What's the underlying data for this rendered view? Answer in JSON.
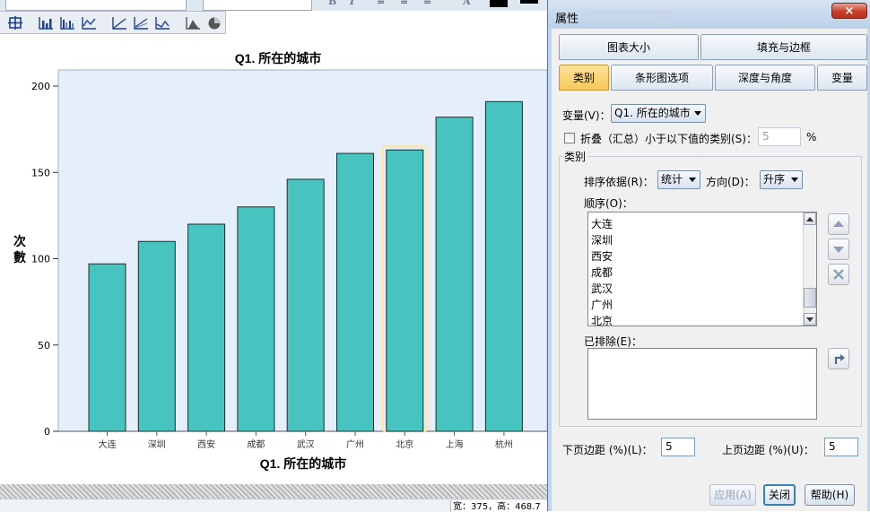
{
  "chart_data": {
    "type": "bar",
    "title": "Q1. 所在的城市",
    "xlabel": "Q1. 所在的城市",
    "ylabel": "次數",
    "categories": [
      "大连",
      "深圳",
      "西安",
      "成都",
      "武汉",
      "广州",
      "北京",
      "上海",
      "杭州"
    ],
    "values": [
      97,
      110,
      120,
      130,
      146,
      161,
      163,
      182,
      191
    ],
    "ylim": [
      0,
      200
    ],
    "yticks": [
      0,
      50,
      100,
      150,
      200
    ],
    "selected_category": "北京",
    "bar_color": "#48c4c0",
    "plot_background": "#e4effb",
    "selection_color": "#ffe69a",
    "grid": false
  },
  "status_bar": {
    "text": "宽：375，高：468.7"
  },
  "dialog": {
    "title": "属性",
    "close_glyph": "×",
    "tabs_row1": [
      "图表大小",
      "填充与边框"
    ],
    "tabs_row2": [
      "类别",
      "条形图选项",
      "深度与角度",
      "变量"
    ],
    "active_tab": "类别",
    "variable_label": "变量(V)：",
    "variable_value": "Q1. 所在的城市",
    "collapse_label": "折叠（汇总）小于以下值的类别(S)：",
    "collapse_value": "5",
    "collapse_unit": "%",
    "collapse_checked": false,
    "group_title": "类别",
    "sort_by_label": "排序依据(R)：",
    "sort_by_value": "统计",
    "direction_label": "方向(D)：",
    "direction_value": "升序",
    "order_label": "顺序(O)：",
    "order_items": [
      "大连",
      "深圳",
      "西安",
      "成都",
      "武汉",
      "广州",
      "北京"
    ],
    "excluded_label": "已排除(E)：",
    "lower_margin_label": "下页边距 (%)(L)：",
    "lower_margin_value": "5",
    "upper_margin_label": "上页边距 (%)(U)：",
    "upper_margin_value": "5",
    "apply_label": "应用(A)",
    "close_label": "关闭",
    "help_label": "帮助(H)"
  },
  "icons": [
    "grid-icon",
    "bar-chart-icon",
    "grouped-bar-icon",
    "line-chart-icon",
    "scatter-icon",
    "scatter-fit-icon",
    "area-icon",
    "mountain-icon",
    "pie-icon",
    "move-up-icon",
    "move-down-icon",
    "delete-icon",
    "restore-icon"
  ]
}
